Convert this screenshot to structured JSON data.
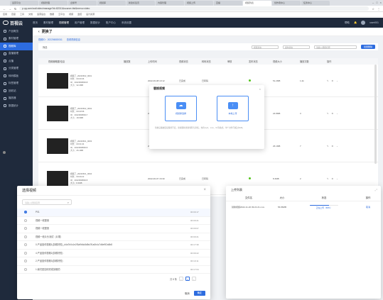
{
  "browser": {
    "tabs": [
      "运营平台",
      "视频管理",
      "企鹅号",
      "视频库",
      "新建标签页",
      "内容管理",
      "视频上传",
      "直播",
      "视频列表",
      "创作者中心",
      "任务中心"
    ],
    "active_tab_index": 8,
    "url": "p.qq.com/vod/video/manage?id=82011&source=list&menu=video",
    "bookmarks": [
      "应用",
      "百度",
      "工具",
      "文档",
      "运营后台",
      "数据",
      "云平台",
      "视频",
      "监控",
      "设计资源"
    ]
  },
  "app": {
    "logo_text": "百视云",
    "top_nav": [
      "首页",
      "素材管理",
      "视频管理",
      "用户管理",
      "数据统计",
      "账户中心",
      "系统设置"
    ],
    "top_nav_active": 2,
    "header_right": [
      "帮助",
      "通知",
      "user001"
    ]
  },
  "sidebar": {
    "items": [
      "产品概览",
      "素材管理",
      "视频库",
      "直播管理",
      "点播",
      "分类管理",
      "转码模板",
      "标签管理",
      "回收站",
      "播放器",
      "数据统计"
    ],
    "active_index": 2
  },
  "page": {
    "back_icon": "chevron-left-icon",
    "title": "更换了",
    "breadcrumbs": [
      "视频ID：202206080011",
      "查看视频信息"
    ],
    "filter": {
      "label": "筛选",
      "selects": [
        "视频状态",
        "发布状态",
        "请输入视频名称"
      ],
      "button": "批量删除"
    },
    "table": {
      "headers": [
        "视频缩略图/信息",
        "播放数",
        "上传时间",
        "视频状态",
        "转码状态",
        "审核",
        "发布状态",
        "视频大小",
        "播放次数",
        "操作"
      ],
      "rows": [
        {
          "name": "视频了_20220602_0001",
          "lines": [
            "时长：00:00:36",
            "ID：202206080018",
            "大小：32.2MB"
          ],
          "time": "2022-06-08 10:12",
          "status": "已完成",
          "transcode": "已转码",
          "size": "51.2MB",
          "plays": "1.2k"
        },
        {
          "name": "视频了_20220602_0002",
          "lines": [
            "时长：00:00:58",
            "ID：202206080017",
            "大小：18.6MB"
          ],
          "time": "2022-06-08 10:08",
          "status": "已完成",
          "transcode": "已转码",
          "size": "24.8MB",
          "plays": "3"
        },
        {
          "name": "视频了_20220601_0003",
          "lines": [
            "时长：00:01:04",
            "ID：202206080016",
            "大小：26.1MB"
          ],
          "time": "2022-06-07 17:42",
          "status": "已完成",
          "transcode": "已转码",
          "size": "26.1MB",
          "plays": "7"
        },
        {
          "name": "视频了_20220601_0004",
          "lines": [
            "时长：00:00:22",
            "ID：202206080015",
            "大小：8.4MB"
          ],
          "time": "2022-06-07 16:30",
          "status": "已完成",
          "transcode": "已转码",
          "size": "8.4MB",
          "plays": "2"
        }
      ]
    }
  },
  "replace_modal": {
    "title": "替换视频",
    "option_left": "视频库选择",
    "option_right": "本地上传",
    "note": "替换后播放链接保持不变，新视频将重新转码与审核。支持mp4、mov、flv等格式，单个文件不超过2GB。"
  },
  "choose_dialog": {
    "title": "选择视频",
    "search_placeholder": "请输入视频名称",
    "items": [
      {
        "name": "P01",
        "duration": "00:00:17",
        "selected": true
      },
      {
        "name": "视频一段配音",
        "duration": "00:00:21",
        "selected": false
      },
      {
        "name": "视频一段配音",
        "duration": "00:00:07",
        "selected": false
      },
      {
        "name": "视频一段片头测试（片尾）",
        "duration": "00:00:21",
        "selected": false
      },
      {
        "name": "0.产品宣传视频1(剪辑好的)_d4a7b0c1e2f3a9b6c8d5e2f1a0b4c7d6e9f2a5b8",
        "duration": "00:17:39",
        "selected": false
      },
      {
        "name": "4.产品宣传视频2(剪辑好的)",
        "duration": "00:09:22",
        "selected": false
      },
      {
        "name": "2.产品宣传视频3(剪辑好的)",
        "duration": "00:10:11",
        "selected": false
      },
      {
        "name": "1.我们是如何完成剪辑的",
        "duration": "00:17:04",
        "selected": false
      }
    ],
    "pager_total": "共 8 条",
    "pager_page": "1",
    "cancel": "取消",
    "ok": "确定"
  },
  "upload_panel": {
    "title": "上传列表",
    "headers": [
      "文件名",
      "大小",
      "状态",
      "操作"
    ],
    "row": {
      "file": "替换视频2022-11-20 09:21:21.mov",
      "size": "56.86MB",
      "progress": 0.68,
      "progress_text": "正在上传（68%）",
      "action": "取消"
    }
  }
}
